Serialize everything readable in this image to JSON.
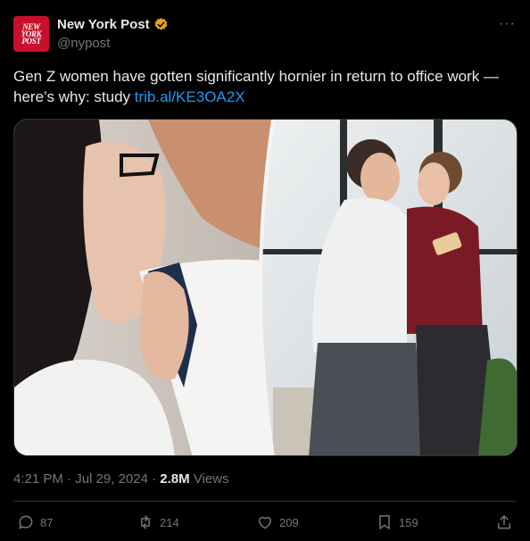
{
  "author": {
    "display_name": "New York Post",
    "handle": "@nypost",
    "avatar_lines": [
      "NEW",
      "YORK",
      "POST"
    ],
    "verified_color": "#e8a20e"
  },
  "more_label": "···",
  "tweet": {
    "text": "Gen Z women have gotten significantly hornier in return to office work — here’s why: study ",
    "link": "trib.al/KE3OA2X"
  },
  "meta": {
    "time": "4:21 PM",
    "sep1": " · ",
    "date": "Jul 29, 2024",
    "sep2": " · ",
    "views": "2.8M",
    "views_label": " Views"
  },
  "actions": {
    "replies": "87",
    "reposts": "214",
    "likes": "209",
    "bookmarks": "159"
  },
  "colors": {
    "background": "#000000",
    "text": "#e7e9ea",
    "muted": "#71767b",
    "link": "#1d9bf0",
    "brand": "#c8102e"
  }
}
